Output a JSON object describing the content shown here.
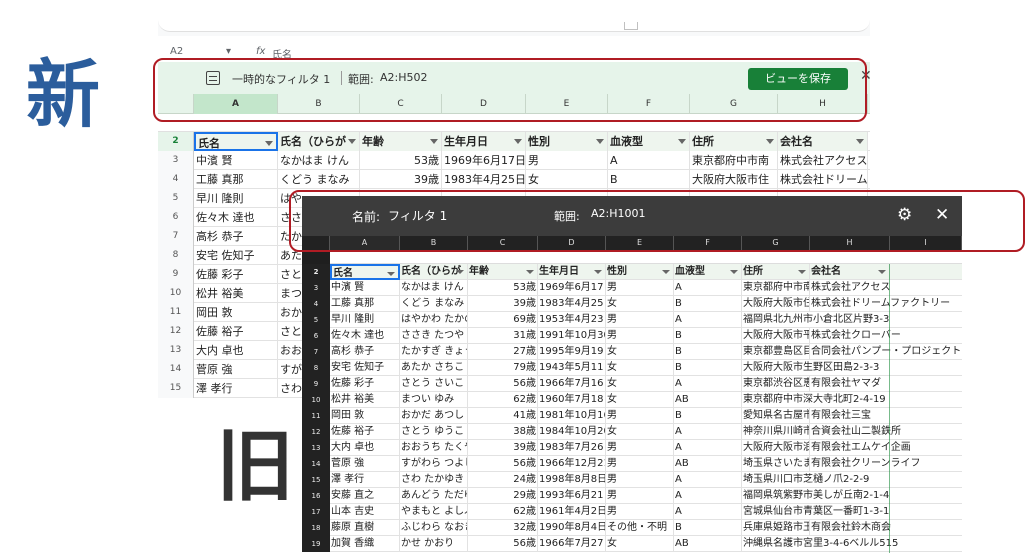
{
  "labels": {
    "new": "新",
    "old": "旧"
  },
  "new_ui": {
    "namebox": "A2",
    "fx_symbol": "fx",
    "fx_value": "氏名",
    "filter_name": "一時的なフィルタ 1",
    "range_label": "範囲:",
    "range_value": "A2:H502",
    "save_button": "ビューを保存",
    "close": "✕",
    "columns": [
      "A",
      "B",
      "C",
      "D",
      "E",
      "F",
      "G",
      "H"
    ],
    "header_row": {
      "num": "2",
      "cells": [
        "氏名",
        "氏名（ひらが",
        "年齢",
        "生年月日",
        "性別",
        "血液型",
        "住所",
        "会社名"
      ]
    },
    "rows": [
      {
        "num": "3",
        "cells": [
          "中濱 賢",
          "なかはま けん",
          "53歳",
          "1969年6月17日",
          "男",
          "A",
          "東京都府中市南",
          "株式会社アクセス"
        ]
      },
      {
        "num": "4",
        "cells": [
          "工藤 真那",
          "くどう まなみ",
          "39歳",
          "1983年4月25日",
          "女",
          "B",
          "大阪府大阪市住",
          "株式会社ドリーム"
        ]
      },
      {
        "num": "5",
        "cells": [
          "早川 隆則",
          "はや",
          "",
          "",
          "",
          "",
          "",
          ""
        ]
      },
      {
        "num": "6",
        "cells": [
          "佐々木 達也",
          "ささ",
          "",
          "",
          "",
          "",
          "",
          ""
        ]
      },
      {
        "num": "7",
        "cells": [
          "高杉 恭子",
          "たか",
          "",
          "",
          "",
          "",
          "",
          ""
        ]
      },
      {
        "num": "8",
        "cells": [
          "安宅 佐知子",
          "あた",
          "",
          "",
          "",
          "",
          "",
          ""
        ]
      },
      {
        "num": "9",
        "cells": [
          "佐藤 彩子",
          "さと",
          "",
          "",
          "",
          "",
          "",
          ""
        ]
      },
      {
        "num": "10",
        "cells": [
          "松井 裕美",
          "まつ",
          "",
          "",
          "",
          "",
          "",
          ""
        ]
      },
      {
        "num": "11",
        "cells": [
          "岡田 敦",
          "おか",
          "",
          "",
          "",
          "",
          "",
          ""
        ]
      },
      {
        "num": "12",
        "cells": [
          "佐藤 裕子",
          "さと",
          "",
          "",
          "",
          "",
          "",
          ""
        ]
      },
      {
        "num": "13",
        "cells": [
          "大内 卓也",
          "おお",
          "",
          "",
          "",
          "",
          "",
          ""
        ]
      },
      {
        "num": "14",
        "cells": [
          "菅原 強",
          "すが",
          "",
          "",
          "",
          "",
          "",
          ""
        ]
      },
      {
        "num": "15",
        "cells": [
          "澤 孝行",
          "さわ",
          "",
          "",
          "",
          "",
          "",
          ""
        ]
      }
    ]
  },
  "old_ui": {
    "name_label": "名前:",
    "name_value": "フィルタ 1",
    "range_label": "範囲:",
    "range_value": "A2:H1001",
    "gear": "⚙",
    "close": "✕",
    "columns": [
      "A",
      "B",
      "C",
      "D",
      "E",
      "F",
      "G",
      "H",
      "I"
    ],
    "header_row": {
      "num": "2",
      "cells": [
        "氏名",
        "氏名（ひらが",
        "年齢",
        "生年月日",
        "性別",
        "血液型",
        "住所",
        "会社名"
      ]
    },
    "rows": [
      {
        "num": "3",
        "cells": [
          "中濱 賢",
          "なかはま けん",
          "53歳",
          "1969年6月17日",
          "男",
          "A",
          "東京都府中市南",
          "株式会社アクセス"
        ]
      },
      {
        "num": "4",
        "cells": [
          "工藤 真那",
          "くどう まなみ",
          "39歳",
          "1983年4月25日",
          "女",
          "B",
          "大阪府大阪市住",
          "株式会社ドリームファクトリー"
        ]
      },
      {
        "num": "5",
        "cells": [
          "早川 隆則",
          "はやかわ たかの",
          "69歳",
          "1953年4月23日",
          "男",
          "A",
          "福岡県北九州市小倉北区片野3-3",
          ""
        ]
      },
      {
        "num": "6",
        "cells": [
          "佐々木 達也",
          "ささき たつや",
          "31歳",
          "1991年10月30日",
          "男",
          "B",
          "大阪府大阪市平",
          "株式会社クローバー"
        ]
      },
      {
        "num": "7",
        "cells": [
          "高杉 恭子",
          "たかすぎ きょう",
          "27歳",
          "1995年9月19日",
          "女",
          "B",
          "東京都豊島区目",
          "合同会社パンプー・プロジェクト"
        ]
      },
      {
        "num": "8",
        "cells": [
          "安宅 佐知子",
          "あたか さちこ",
          "79歳",
          "1943年5月11日",
          "女",
          "B",
          "大阪府大阪市生野区田島2-3-3",
          ""
        ]
      },
      {
        "num": "9",
        "cells": [
          "佐藤 彩子",
          "さとう さいこ",
          "56歳",
          "1966年7月16日",
          "女",
          "A",
          "東京都渋谷区恵",
          "有限会社ヤマダ"
        ]
      },
      {
        "num": "10",
        "cells": [
          "松井 裕美",
          "まつい ゆみ",
          "62歳",
          "1960年7月18日",
          "女",
          "AB",
          "東京都府中市深大寺北町2-4-19",
          ""
        ]
      },
      {
        "num": "11",
        "cells": [
          "岡田 敦",
          "おかだ あつし",
          "41歳",
          "1981年10月16日",
          "男",
          "B",
          "愛知県名古屋市",
          "有限会社三宝"
        ]
      },
      {
        "num": "12",
        "cells": [
          "佐藤 裕子",
          "さとう ゆうこ",
          "38歳",
          "1984年10月20日",
          "女",
          "A",
          "神奈川県川崎市",
          "合資会社山二製鉄所"
        ]
      },
      {
        "num": "13",
        "cells": [
          "大内 卓也",
          "おおうち たくや",
          "39歳",
          "1983年7月26日",
          "男",
          "A",
          "大阪府大阪市浪",
          "有限会社エムケイ企画"
        ]
      },
      {
        "num": "14",
        "cells": [
          "菅原 強",
          "すがわら つよし",
          "56歳",
          "1966年12月21日",
          "男",
          "AB",
          "埼玉県さいたま",
          "有限会社クリーンライフ"
        ]
      },
      {
        "num": "15",
        "cells": [
          "澤 孝行",
          "さわ たかゆき",
          "24歳",
          "1998年8月8日",
          "男",
          "A",
          "埼玉県川口市芝樋ノ爪2-2-9",
          ""
        ]
      },
      {
        "num": "16",
        "cells": [
          "安藤 直之",
          "あんどう ただゆ",
          "29歳",
          "1993年6月21日",
          "男",
          "A",
          "福岡県筑紫野市美しが丘南2-1-4",
          ""
        ]
      },
      {
        "num": "17",
        "cells": [
          "山本 吉史",
          "やまもと よしふ",
          "62歳",
          "1961年4月2日",
          "男",
          "A",
          "宮城県仙台市青葉区一番町1-3-1",
          ""
        ]
      },
      {
        "num": "18",
        "cells": [
          "藤原 直樹",
          "ふじわら なおき",
          "32歳",
          "1990年8月4日",
          "その他・不明",
          "B",
          "兵庫県姫路市玉",
          "有限会社鈴木商会"
        ]
      },
      {
        "num": "19",
        "cells": [
          "加賀 香織",
          "かせ かおり",
          "56歳",
          "1966年7月27日",
          "女",
          "AB",
          "沖縄県名護市宮里3-4-6ベルル515",
          ""
        ]
      }
    ]
  }
}
